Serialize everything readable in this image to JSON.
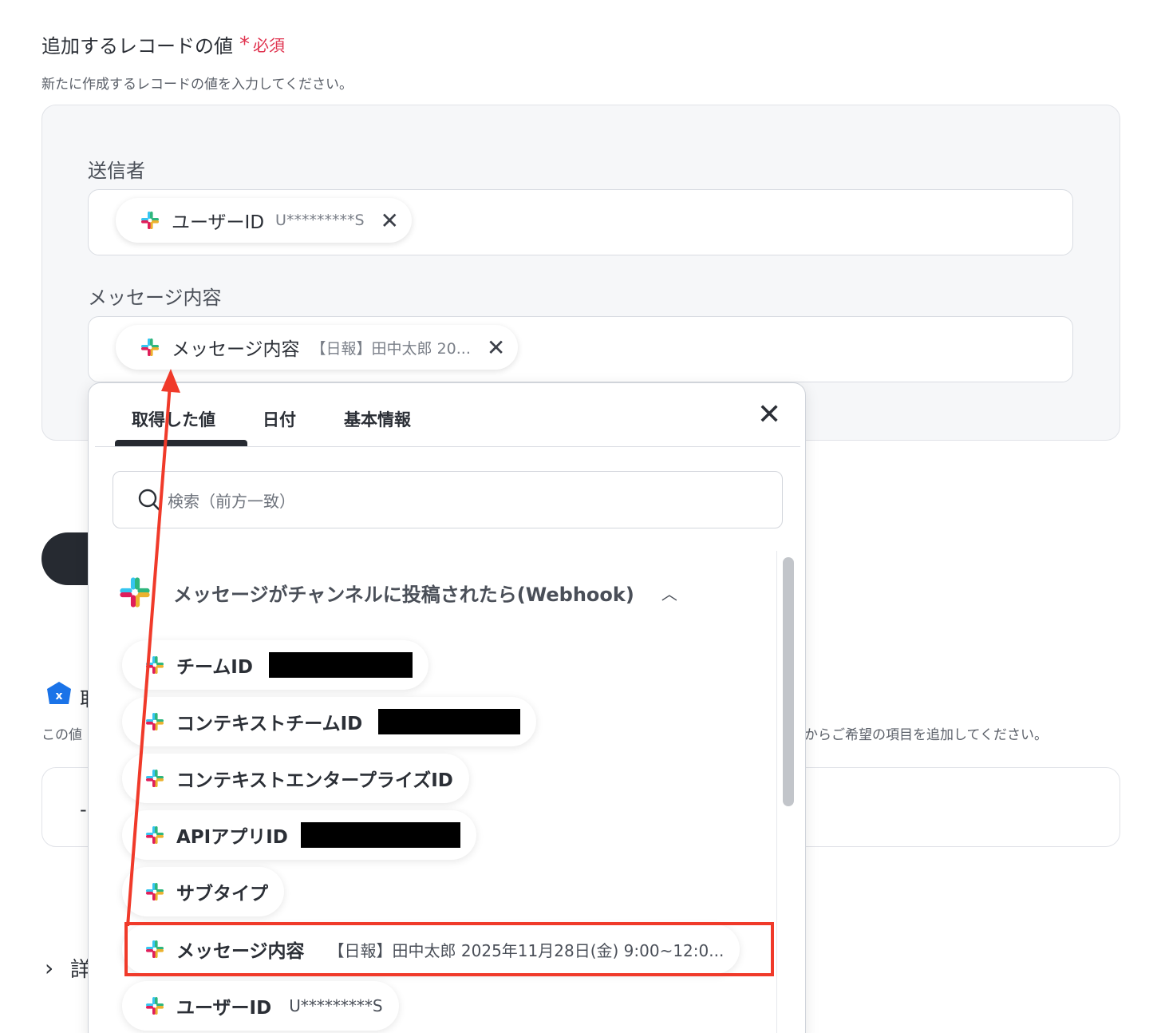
{
  "section": {
    "title": "追加するレコードの値",
    "required_star": "*",
    "required_label": "必須",
    "description": "新たに作成するレコードの値を入力してください。"
  },
  "fields": [
    {
      "label": "送信者",
      "chip_label": "ユーザーID",
      "chip_value": "U*********S"
    },
    {
      "label": "メッセージ内容",
      "chip_label": "メッセージ内容",
      "chip_value": "【日報】田中太郎 20..."
    }
  ],
  "background": {
    "partial_text_a": "取",
    "partial_text_b": "この値",
    "partial_text_c": "からご希望の項目を追加してください。",
    "partial_dash": "-",
    "detail_partial": "詳"
  },
  "popup": {
    "tabs": [
      "取得した値",
      "日付",
      "基本情報"
    ],
    "active_tab": 0,
    "search_placeholder": "検索（前方一致）",
    "group_title": "メッセージがチャンネルに投稿されたら(Webhook)",
    "items": [
      {
        "label": "チームID",
        "value": "",
        "redacted": true
      },
      {
        "label": "コンテキストチームID",
        "value": "",
        "redacted": true
      },
      {
        "label": "コンテキストエンタープライズID",
        "value": "",
        "redacted": false
      },
      {
        "label": "APIアプリID",
        "value": "",
        "redacted": true
      },
      {
        "label": "サブタイプ",
        "value": "",
        "redacted": false
      },
      {
        "label": "メッセージ内容",
        "value": "【日報】田中太郎 2025年11月28日(金) 9:00~12:0...",
        "redacted": false,
        "highlighted": true
      },
      {
        "label": "ユーザーID",
        "value": "U*********S",
        "redacted": false
      }
    ]
  },
  "icons": {
    "chip_icon": "slack-icon",
    "close": "close-icon",
    "search": "search-icon",
    "caret": "chevron-up-icon",
    "brand": "x-logo-icon"
  },
  "colors": {
    "required": "#e0334f",
    "highlight": "#f03a2a",
    "dark": "#262a31"
  }
}
